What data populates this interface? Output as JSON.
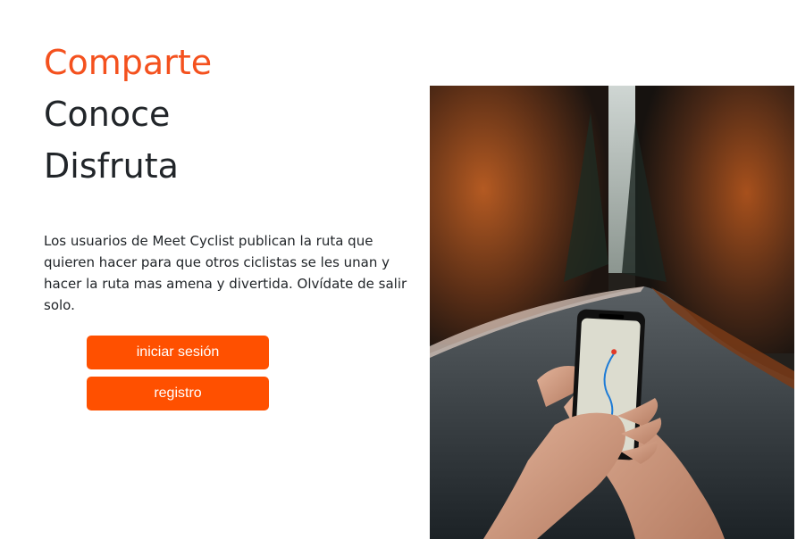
{
  "hero": {
    "line1": "Comparte",
    "line2": "Conoce",
    "line3": "Disfruta",
    "description": "Los usuarios de Meet Cyclist publican la ruta que quieren hacer para que otros ciclistas se les unan y hacer la ruta mas amena y divertida. Olvídate de salir solo."
  },
  "actions": {
    "login_label": "iniciar sesión",
    "register_label": "registro"
  },
  "colors": {
    "accent": "#f4511e",
    "button": "#ff5000",
    "text": "#212529"
  }
}
